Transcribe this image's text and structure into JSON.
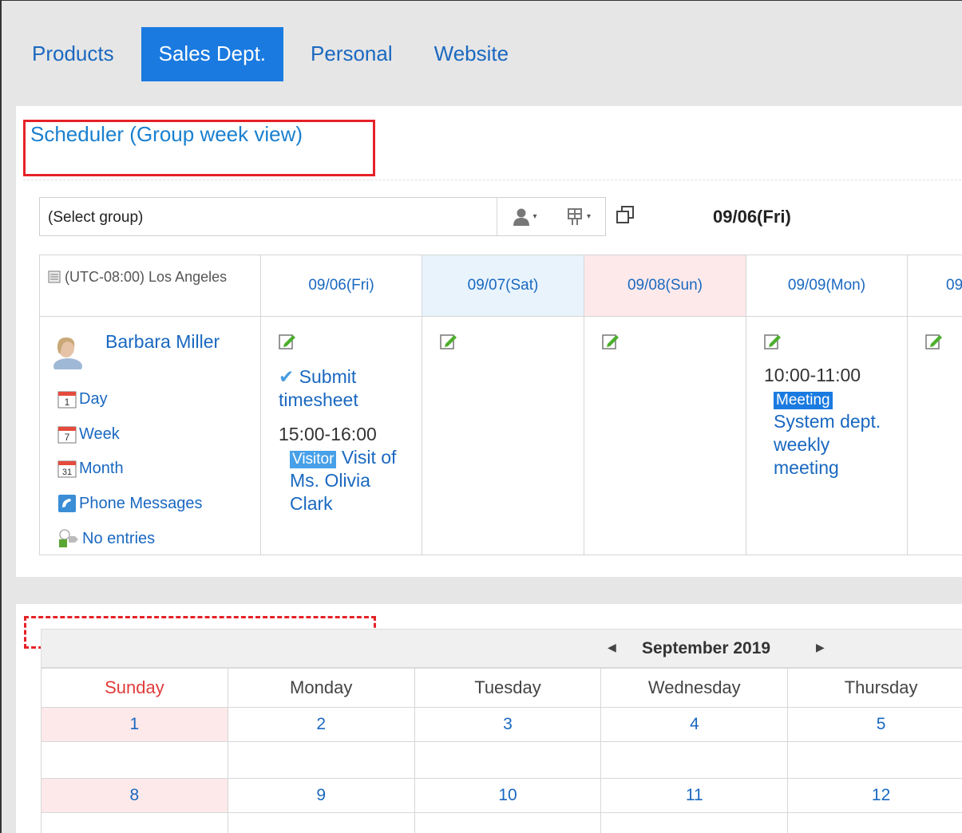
{
  "tabs": [
    {
      "label": "Products"
    },
    {
      "label": "Sales Dept."
    },
    {
      "label": "Personal"
    },
    {
      "label": "Website"
    }
  ],
  "scheduler": {
    "title": "Scheduler (Group week view)",
    "group_select": "(Select group)",
    "current_date": "09/06(Fri)",
    "timezone": "(UTC-08:00) Los Angeles",
    "days": [
      {
        "label": "09/06(Fri)"
      },
      {
        "label": "09/07(Sat)"
      },
      {
        "label": "09/08(Sun)"
      },
      {
        "label": "09/09(Mon)"
      },
      {
        "label": "09"
      }
    ],
    "user": {
      "name": "Barbara Miller",
      "links": {
        "day": "Day",
        "week": "Week",
        "month": "Month",
        "phone": "Phone Messages",
        "entries": "No entries"
      }
    },
    "events": {
      "fri": {
        "todo": "Submit timesheet",
        "time": "15:00-16:00",
        "tag": "Visitor",
        "title": "Visit of Ms. Olivia Clark"
      },
      "mon": {
        "time": "10:00-11:00",
        "tag": "Meeting",
        "title": "System dept. weekly meeting"
      }
    }
  },
  "calendar": {
    "month_title": "September 2019",
    "weekdays": [
      "Sunday",
      "Monday",
      "Tuesday",
      "Wednesday",
      "Thursday"
    ],
    "weeks": [
      [
        "1",
        "2",
        "3",
        "4",
        "5"
      ],
      [
        "8",
        "9",
        "10",
        "11",
        "12"
      ]
    ]
  },
  "icons": {
    "accent": "#1a7ae0",
    "highlight_red": "#e52228"
  }
}
